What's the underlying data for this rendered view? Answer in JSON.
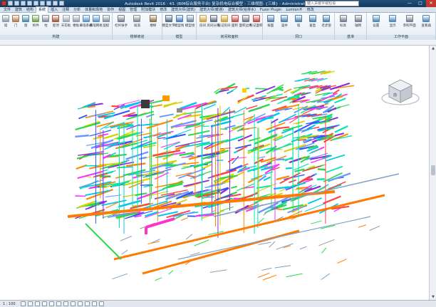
{
  "title_bar": {
    "title": "Autodesk Revit 2016 - 43. (BIM综合服务平台) 复杂机电综合模型 - 三维视图: {三维} - Administrator",
    "search_placeholder": "键入关键字或短语",
    "minimize": "—",
    "maximize": "□",
    "close": "✕"
  },
  "tabs": [
    {
      "label": "文件",
      "active": false
    },
    {
      "label": "建筑",
      "active": false
    },
    {
      "label": "结构",
      "active": false
    },
    {
      "label": "系统",
      "active": true
    },
    {
      "label": "插入",
      "active": false
    },
    {
      "label": "注释",
      "active": false
    },
    {
      "label": "分析",
      "active": false
    },
    {
      "label": "体量和场地",
      "active": false
    },
    {
      "label": "协作",
      "active": false
    },
    {
      "label": "视图",
      "active": false
    },
    {
      "label": "管理",
      "active": false
    },
    {
      "label": "附加模块",
      "active": false
    },
    {
      "label": "修改",
      "active": false
    },
    {
      "label": "建筑大师(建筑)",
      "active": false
    },
    {
      "label": "建筑大师(暖通)",
      "active": false
    },
    {
      "label": "建筑大师(给排水)",
      "active": false
    },
    {
      "label": "Fuzor Plugin",
      "active": false
    },
    {
      "label": "Lumion®",
      "active": false
    },
    {
      "label": "修改",
      "active": false
    }
  ],
  "ribbon": {
    "panels": [
      {
        "name": "构建",
        "buttons": [
          {
            "label": "墙",
            "icon": "wall-icon",
            "color": "#8a9bb0"
          },
          {
            "label": "门",
            "icon": "door-icon",
            "color": "#b07a4a"
          },
          {
            "label": "窗",
            "icon": "window-icon",
            "color": "#4a8ab0"
          },
          {
            "label": "构件",
            "icon": "component-icon",
            "color": "#6aa04a"
          },
          {
            "label": "柱",
            "icon": "column-icon",
            "color": "#7f8c99"
          },
          {
            "label": "屋顶",
            "icon": "roof-icon",
            "color": "#a0543a"
          },
          {
            "label": "天花板",
            "icon": "ceiling-icon",
            "color": "#9aa6b3"
          },
          {
            "label": "楼板",
            "icon": "floor-icon",
            "color": "#8f9aa5"
          },
          {
            "label": "幕墙系统",
            "icon": "curtain-system-icon",
            "color": "#5c8fc2"
          },
          {
            "label": "幕墙网格",
            "icon": "curtain-grid-icon",
            "color": "#5c8fc2"
          },
          {
            "label": "竖梃",
            "icon": "mullion-icon",
            "color": "#8190a0"
          }
        ]
      },
      {
        "name": "楼梯坡道",
        "buttons": [
          {
            "label": "栏杆扶手",
            "icon": "railing-icon",
            "color": "#6f7d8c"
          },
          {
            "label": "坡道",
            "icon": "ramp-icon",
            "color": "#7d8b99"
          },
          {
            "label": "楼梯",
            "icon": "stair-icon",
            "color": "#8b6f4a"
          }
        ]
      },
      {
        "name": "模型",
        "buttons": [
          {
            "label": "模型文字",
            "icon": "model-text-icon",
            "color": "#4f6b88"
          },
          {
            "label": "模型线",
            "icon": "model-line-icon",
            "color": "#3d7cc2"
          },
          {
            "label": "模型组",
            "icon": "model-group-icon",
            "color": "#6a88a6"
          }
        ]
      },
      {
        "name": "房间和面积",
        "buttons": [
          {
            "label": "房间",
            "icon": "room-icon",
            "color": "#c9a13a"
          },
          {
            "label": "房间分隔",
            "icon": "room-separator-icon",
            "color": "#5a6b7c"
          },
          {
            "label": "标记房间",
            "icon": "tag-room-icon",
            "color": "#c9a13a"
          },
          {
            "label": "面积",
            "icon": "area-icon",
            "color": "#c24a4a"
          },
          {
            "label": "面积边界",
            "icon": "area-boundary-icon",
            "color": "#6b7785"
          },
          {
            "label": "标记面积",
            "icon": "tag-area-icon",
            "color": "#c24a4a"
          }
        ]
      },
      {
        "name": "洞口",
        "buttons": [
          {
            "label": "按面",
            "icon": "by-face-icon",
            "color": "#4a7fb0"
          },
          {
            "label": "竖井",
            "icon": "shaft-icon",
            "color": "#4a7fb0"
          },
          {
            "label": "墙",
            "icon": "wall-opening-icon",
            "color": "#4a7fb0"
          },
          {
            "label": "垂直",
            "icon": "vertical-opening-icon",
            "color": "#4a7fb0"
          },
          {
            "label": "老虎窗",
            "icon": "dormer-icon",
            "color": "#4a7fb0"
          }
        ]
      },
      {
        "name": "基准",
        "buttons": [
          {
            "label": "标高",
            "icon": "level-icon",
            "color": "#6f7d8c"
          },
          {
            "label": "轴网",
            "icon": "grid-icon",
            "color": "#6f7d8c"
          }
        ]
      },
      {
        "name": "工作平面",
        "buttons": [
          {
            "label": "设置",
            "icon": "set-workplane-icon",
            "color": "#4a88b8"
          },
          {
            "label": "显示",
            "icon": "show-workplane-icon",
            "color": "#4a88b8"
          },
          {
            "label": "参照平面",
            "icon": "ref-plane-icon",
            "color": "#6f7d8c"
          },
          {
            "label": "查看器",
            "icon": "viewer-icon",
            "color": "#4a88b8"
          }
        ]
      }
    ]
  },
  "viewcube": {
    "label": "前"
  },
  "status_bar": {
    "scale": "1 : 100"
  },
  "scrollbar": {
    "up": "▲",
    "down": "▼"
  }
}
